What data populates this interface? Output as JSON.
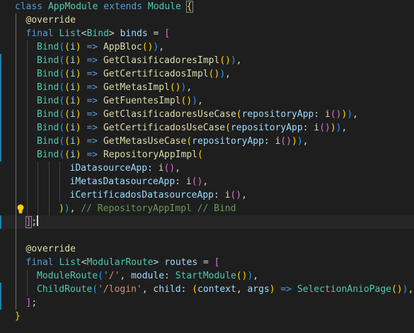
{
  "lines": [
    {
      "indent": 0,
      "tokens": [
        [
          "kw",
          "class "
        ],
        [
          "ty",
          "AppModule "
        ],
        [
          "kw",
          "extends "
        ],
        [
          "ty",
          "Module "
        ],
        [
          "b1",
          "{"
        ]
      ]
    },
    {
      "indent": 1,
      "tokens": [
        [
          "fn",
          "@override"
        ]
      ]
    },
    {
      "indent": 1,
      "tokens": [
        [
          "kw",
          "final "
        ],
        [
          "ty",
          "List"
        ],
        [
          "pn",
          "<"
        ],
        [
          "ty",
          "Bind"
        ],
        [
          "pn",
          "> "
        ],
        [
          "vr",
          "binds"
        ],
        [
          "pn",
          " = "
        ],
        [
          "b2",
          "["
        ]
      ]
    },
    {
      "indent": 2,
      "tokens": [
        [
          "ty",
          "Bind"
        ],
        [
          "b3",
          "("
        ],
        [
          "b1",
          "("
        ],
        [
          "vr",
          "i"
        ],
        [
          "b1",
          ")"
        ],
        [
          "kw",
          " => "
        ],
        [
          "fn",
          "AppBloc"
        ],
        [
          "b1",
          "()"
        ],
        [
          "b3",
          ")"
        ],
        [
          "pn",
          ","
        ]
      ]
    },
    {
      "indent": 2,
      "tokens": [
        [
          "ty",
          "Bind"
        ],
        [
          "b3",
          "("
        ],
        [
          "b1",
          "("
        ],
        [
          "vr",
          "i"
        ],
        [
          "b1",
          ")"
        ],
        [
          "kw",
          " => "
        ],
        [
          "fn",
          "GetClasificadoresImpl"
        ],
        [
          "b1",
          "()"
        ],
        [
          "b3",
          ")"
        ],
        [
          "pn",
          ","
        ]
      ]
    },
    {
      "indent": 2,
      "tokens": [
        [
          "ty",
          "Bind"
        ],
        [
          "b3",
          "("
        ],
        [
          "b1",
          "("
        ],
        [
          "vr",
          "i"
        ],
        [
          "b1",
          ")"
        ],
        [
          "kw",
          " => "
        ],
        [
          "fn",
          "GetCertificadosImpl"
        ],
        [
          "b1",
          "()"
        ],
        [
          "b3",
          ")"
        ],
        [
          "pn",
          ","
        ]
      ]
    },
    {
      "indent": 2,
      "tokens": [
        [
          "ty",
          "Bind"
        ],
        [
          "b3",
          "("
        ],
        [
          "b1",
          "("
        ],
        [
          "vr",
          "i"
        ],
        [
          "b1",
          ")"
        ],
        [
          "kw",
          " => "
        ],
        [
          "fn",
          "GetMetasImpl"
        ],
        [
          "b1",
          "()"
        ],
        [
          "b3",
          ")"
        ],
        [
          "pn",
          ","
        ]
      ]
    },
    {
      "indent": 2,
      "tokens": [
        [
          "ty",
          "Bind"
        ],
        [
          "b3",
          "("
        ],
        [
          "b1",
          "("
        ],
        [
          "vr",
          "i"
        ],
        [
          "b1",
          ")"
        ],
        [
          "kw",
          " => "
        ],
        [
          "fn",
          "GetFuentesImpl"
        ],
        [
          "b1",
          "()"
        ],
        [
          "b3",
          ")"
        ],
        [
          "pn",
          ","
        ]
      ]
    },
    {
      "indent": 2,
      "tokens": [
        [
          "ty",
          "Bind"
        ],
        [
          "b3",
          "("
        ],
        [
          "b1",
          "("
        ],
        [
          "vr",
          "i"
        ],
        [
          "b1",
          ")"
        ],
        [
          "kw",
          " => "
        ],
        [
          "fn",
          "GetClasificadoresUseCase"
        ],
        [
          "b1",
          "("
        ],
        [
          "vr",
          "repositoryApp"
        ],
        [
          "pn",
          ": "
        ],
        [
          "fn",
          "i"
        ],
        [
          "b2",
          "()"
        ],
        [
          "b1",
          ")"
        ],
        [
          "b3",
          ")"
        ],
        [
          "pn",
          ","
        ]
      ]
    },
    {
      "indent": 2,
      "tokens": [
        [
          "ty",
          "Bind"
        ],
        [
          "b3",
          "("
        ],
        [
          "b1",
          "("
        ],
        [
          "vr",
          "i"
        ],
        [
          "b1",
          ")"
        ],
        [
          "kw",
          " => "
        ],
        [
          "fn",
          "GetCertificadosUseCase"
        ],
        [
          "b1",
          "("
        ],
        [
          "vr",
          "repositoryApp"
        ],
        [
          "pn",
          ": "
        ],
        [
          "fn",
          "i"
        ],
        [
          "b2",
          "()"
        ],
        [
          "b1",
          ")"
        ],
        [
          "b3",
          ")"
        ],
        [
          "pn",
          ","
        ]
      ]
    },
    {
      "indent": 2,
      "tokens": [
        [
          "ty",
          "Bind"
        ],
        [
          "b3",
          "("
        ],
        [
          "b1",
          "("
        ],
        [
          "vr",
          "i"
        ],
        [
          "b1",
          ")"
        ],
        [
          "kw",
          " => "
        ],
        [
          "fn",
          "GetMetasUseCase"
        ],
        [
          "b1",
          "("
        ],
        [
          "vr",
          "repositoryApp"
        ],
        [
          "pn",
          ": "
        ],
        [
          "fn",
          "i"
        ],
        [
          "b2",
          "()"
        ],
        [
          "b1",
          ")"
        ],
        [
          "b3",
          ")"
        ],
        [
          "pn",
          ","
        ]
      ]
    },
    {
      "indent": 2,
      "tokens": [
        [
          "ty",
          "Bind"
        ],
        [
          "b3",
          "("
        ],
        [
          "b1",
          "("
        ],
        [
          "vr",
          "i"
        ],
        [
          "b1",
          ")"
        ],
        [
          "kw",
          " => "
        ],
        [
          "fn",
          "RepositoryAppImpl"
        ],
        [
          "b1",
          "("
        ]
      ]
    },
    {
      "indent": 5,
      "tokens": [
        [
          "vr",
          "iDatasourceApp"
        ],
        [
          "pn",
          ": "
        ],
        [
          "fn",
          "i"
        ],
        [
          "b2",
          "()"
        ],
        [
          "pn",
          ","
        ]
      ]
    },
    {
      "indent": 5,
      "tokens": [
        [
          "vr",
          "iMetasDatasourceApp"
        ],
        [
          "pn",
          ": "
        ],
        [
          "fn",
          "i"
        ],
        [
          "b2",
          "()"
        ],
        [
          "pn",
          ","
        ]
      ]
    },
    {
      "indent": 5,
      "tokens": [
        [
          "vr",
          "iCertificadosDatasourceApp"
        ],
        [
          "pn",
          ": "
        ],
        [
          "fn",
          "i"
        ],
        [
          "b2",
          "()"
        ],
        [
          "pn",
          ","
        ]
      ]
    },
    {
      "indent": 4,
      "tokens": [
        [
          "b1",
          ")"
        ],
        [
          "b3",
          ")"
        ],
        [
          "pn",
          ", "
        ],
        [
          "cm",
          "// RepositoryAppImpl // Bind"
        ]
      ]
    },
    {
      "indent": 1,
      "tokens": [
        [
          "b2",
          "]"
        ],
        [
          "pn",
          ";"
        ]
      ]
    },
    {
      "indent": 0,
      "tokens": []
    },
    {
      "indent": 1,
      "tokens": [
        [
          "fn",
          "@override"
        ]
      ]
    },
    {
      "indent": 1,
      "tokens": [
        [
          "kw",
          "final "
        ],
        [
          "ty",
          "List"
        ],
        [
          "pn",
          "<"
        ],
        [
          "ty",
          "ModularRoute"
        ],
        [
          "pn",
          "> "
        ],
        [
          "vr",
          "routes"
        ],
        [
          "pn",
          " = "
        ],
        [
          "b2",
          "["
        ]
      ]
    },
    {
      "indent": 2,
      "tokens": [
        [
          "ty",
          "ModuleRoute"
        ],
        [
          "b3",
          "("
        ],
        [
          "st",
          "'/'"
        ],
        [
          "pn",
          ", "
        ],
        [
          "vr",
          "module"
        ],
        [
          "pn",
          ": "
        ],
        [
          "ty",
          "StartModule"
        ],
        [
          "b1",
          "()"
        ],
        [
          "b3",
          ")"
        ],
        [
          "pn",
          ","
        ]
      ]
    },
    {
      "indent": 2,
      "tokens": [
        [
          "ty",
          "ChildRoute"
        ],
        [
          "b3",
          "("
        ],
        [
          "st",
          "'/login'"
        ],
        [
          "pn",
          ", "
        ],
        [
          "vr",
          "child"
        ],
        [
          "pn",
          ": "
        ],
        [
          "b1",
          "("
        ],
        [
          "vr",
          "context"
        ],
        [
          "pn",
          ", "
        ],
        [
          "vr",
          "args"
        ],
        [
          "b1",
          ")"
        ],
        [
          "kw",
          " => "
        ],
        [
          "ty",
          "SelectionAnioPage"
        ],
        [
          "b1",
          "()"
        ],
        [
          "b3",
          ")"
        ],
        [
          "pn",
          ","
        ]
      ]
    },
    {
      "indent": 1,
      "tokens": [
        [
          "b2",
          "]"
        ],
        [
          "pn",
          ";"
        ]
      ]
    },
    {
      "indent": 0,
      "tokens": [
        [
          "b1",
          "}"
        ]
      ]
    }
  ]
}
